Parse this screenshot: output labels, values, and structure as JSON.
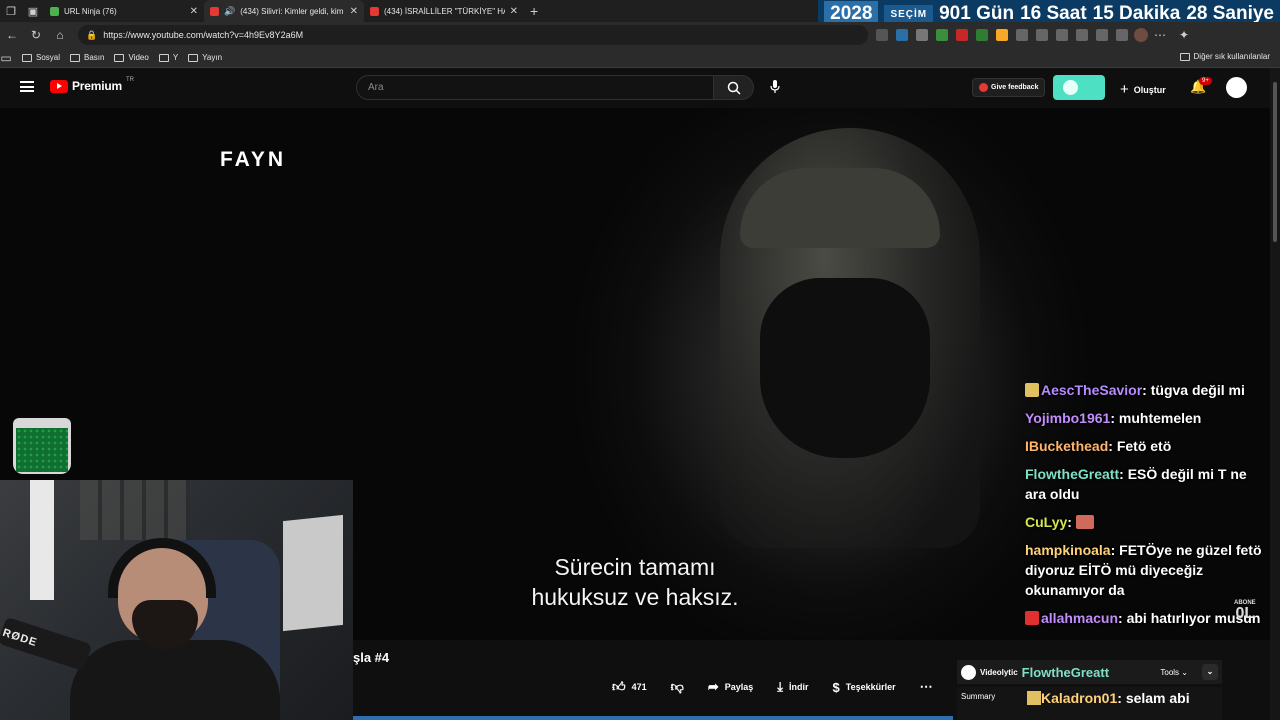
{
  "browser": {
    "tabs": [
      {
        "title": "URL Ninja (76)"
      },
      {
        "title": "(434) Silivri: Kimler geldi, kim"
      },
      {
        "title": "(434) İSRAİLLİLER \"TÜRKİYE\" HAK"
      }
    ],
    "url": "https://www.youtube.com/watch?v=4h9Ev8Y2a6M",
    "bookmarks": [
      "Sosyal",
      "Basın",
      "Video",
      "Y",
      "Yayın"
    ],
    "bookmarks_other": "Diğer sık kullanılanlar"
  },
  "countdown": {
    "year": "2028",
    "label": "SEÇİM",
    "days": "901 Gün",
    "hours": "16 Saat",
    "minutes": "15 Dakika",
    "seconds": "28 Saniye"
  },
  "youtube": {
    "logo_text": "Premium",
    "region": "TR",
    "search_placeholder": "Ara",
    "feedback_label": "Give feedback",
    "create_label": "Oluştur",
    "notif_badge": "9+"
  },
  "video": {
    "watermark": "FAYN",
    "subtitle_line1": "Sürecin tamamı",
    "subtitle_line2": "hukuksuz ve haksız.",
    "title_fragment": "şla #4",
    "likes": "471",
    "share_label": "Paylaş",
    "download_label": "İndir",
    "thanks_label": "Teşekkürler"
  },
  "chat": [
    {
      "user": "AescTheSavior",
      "text": "tügva değil mi",
      "color": "#b58cff",
      "icon_color": "#e0c060"
    },
    {
      "user": "Yojimbo1961",
      "text": "muhtemelen",
      "color": "#c38dff",
      "icon_color": ""
    },
    {
      "user": "IBuckethead",
      "text": "Fetö etö",
      "color": "#ffb46a",
      "icon_color": ""
    },
    {
      "user": "FlowtheGreatt",
      "text": "ESÖ değil mi T ne ara oldu",
      "color": "#7fe0c6",
      "icon_color": ""
    },
    {
      "user": "CuLyy",
      "text": "",
      "color": "#d7e84a",
      "icon_color": "#d06a5a"
    },
    {
      "user": "hampkinoala",
      "text": "FETÖye ne güzel fetö diyoruz EİTÖ mü diyeceğiz okunamıyor da",
      "color": "#ffd27a",
      "icon_color": ""
    },
    {
      "user": "allahmacun",
      "text": "abi hatırlıyor musun",
      "color": "#c38dff",
      "icon_color": "#e03030"
    }
  ],
  "abone": {
    "label": "ABONE",
    "count": "0L"
  },
  "videolytics": {
    "name": "Videolytic",
    "overlay_user": "FlowtheGreatt",
    "tools": "Tools",
    "summary": "Summary",
    "overlay_msg_user": "Kaladron01",
    "overlay_msg_text": "selam abi"
  },
  "webcam": {
    "mic_brand": "RØDE"
  },
  "colors": {
    "accent": "#ff0000",
    "toggle": "#4ee0c2",
    "countdown_bg": "#0b3b63"
  }
}
